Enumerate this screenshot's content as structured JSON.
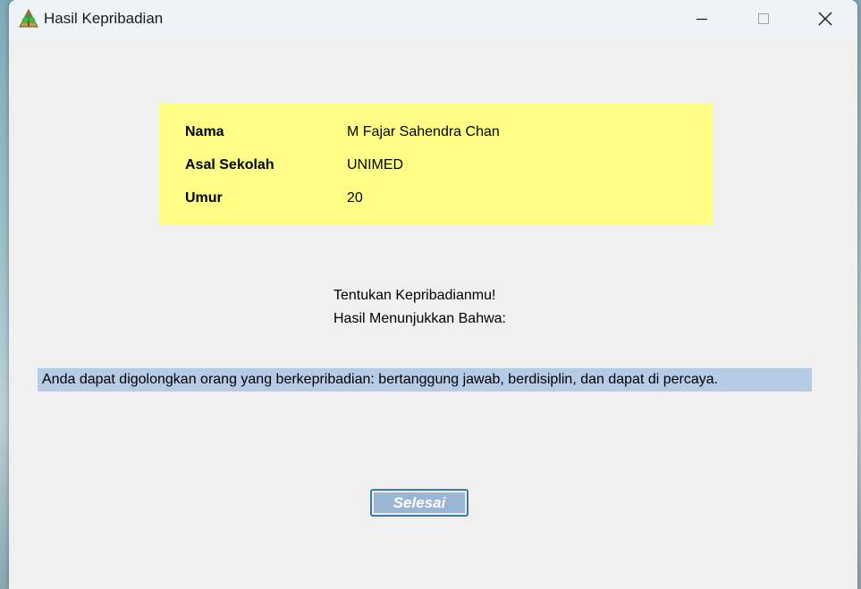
{
  "window": {
    "title": "Hasil Kepribadian",
    "icon": "tree-app-icon",
    "controls": [
      "minimize-icon",
      "maximize-icon",
      "close-icon"
    ]
  },
  "profile": {
    "name_label": "Nama",
    "name_value": "M Fajar Sahendra Chan",
    "school_label": "Asal Sekolah",
    "school_value": "UNIMED",
    "age_label": "Umur",
    "age_value": "20",
    "panel_color": "#ffff88"
  },
  "result": {
    "heading_line1": "Tentukan Kepribadianmu!",
    "heading_line2": "Hasil Menunjukkan Bahwa:",
    "text": "Anda dapat digolongkan orang yang berkepribadian: bertanggung jawab, berdisiplin, dan dapat di percaya.",
    "highlight_color": "#b5cbe6"
  },
  "actions": {
    "done_label": "Selesai"
  }
}
